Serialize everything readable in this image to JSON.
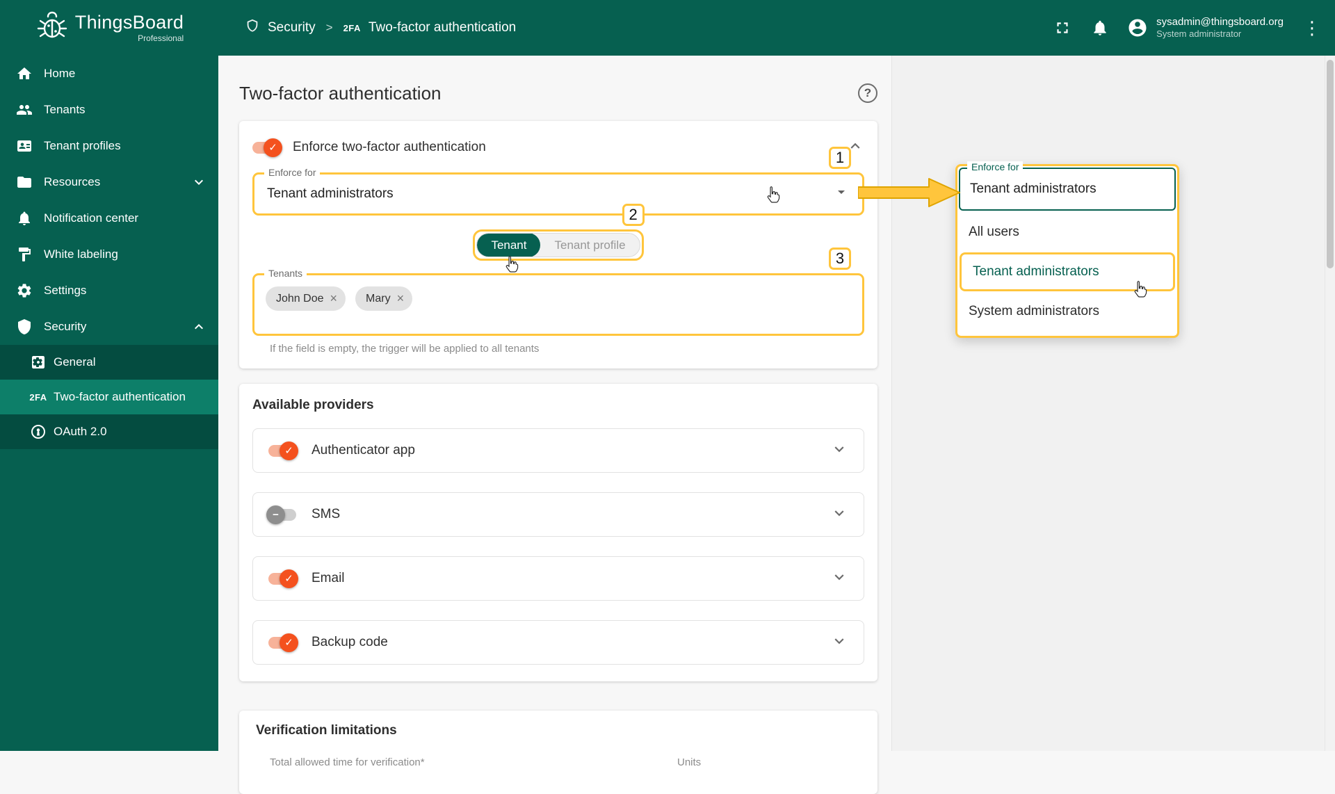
{
  "colors": {
    "primary": "#066050",
    "toggle_on": "#f4511e",
    "annotation_yellow": "#ffc53c"
  },
  "icons": {
    "twofa": "2FA",
    "help": "?",
    "dots": "⋮",
    "check": "✓",
    "minus": "−",
    "close": "×",
    "separator": ">"
  },
  "header": {
    "brand": "ThingsBoard",
    "edition": "Professional",
    "breadcrumb_section": "Security",
    "breadcrumb_page": "Two-factor authentication",
    "user_email": "sysadmin@thingsboard.org",
    "user_role": "System administrator"
  },
  "sidebar": {
    "items": [
      {
        "label": "Home"
      },
      {
        "label": "Tenants"
      },
      {
        "label": "Tenant profiles"
      },
      {
        "label": "Resources"
      },
      {
        "label": "Notification center"
      },
      {
        "label": "White labeling"
      },
      {
        "label": "Settings"
      },
      {
        "label": "Security"
      }
    ],
    "security_children": [
      {
        "label": "General"
      },
      {
        "label": "Two-factor authentication"
      },
      {
        "label": "OAuth 2.0"
      }
    ]
  },
  "page": {
    "title": "Two-factor authentication"
  },
  "enforce": {
    "toggle_label": "Enforce two-factor authentication",
    "field_label": "Enforce for",
    "field_value": "Tenant administrators",
    "scope_options": [
      "Tenant",
      "Tenant profile"
    ],
    "tenants_label": "Tenants",
    "chips": [
      "John Doe",
      "Mary"
    ],
    "hint": "If the field is empty, the trigger will be applied to all tenants"
  },
  "providers": {
    "title": "Available providers",
    "items": [
      {
        "label": "Authenticator app",
        "enabled": true
      },
      {
        "label": "SMS",
        "enabled": false
      },
      {
        "label": "Email",
        "enabled": true
      },
      {
        "label": "Backup code",
        "enabled": true
      }
    ]
  },
  "verification": {
    "title": "Verification limitations",
    "field_label": "Total allowed time for verification*",
    "units_label": "Units"
  },
  "steps": {
    "one": "1",
    "two": "2",
    "three": "3"
  },
  "panel": {
    "field_label": "Enforce for",
    "field_value": "Tenant administrators",
    "options": [
      "All users",
      "Tenant administrators",
      "System administrators"
    ],
    "selected": "Tenant administrators"
  }
}
